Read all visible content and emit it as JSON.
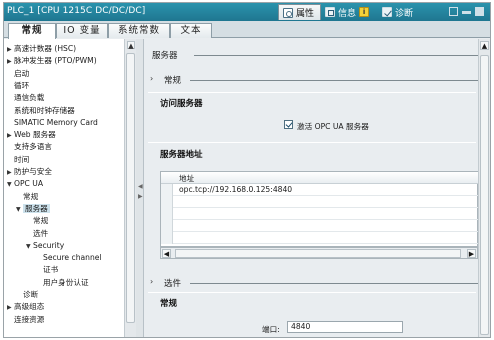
{
  "window": {
    "title": "PLC_1 [CPU 1215C DC/DC/DC]"
  },
  "inspector_tabs": [
    {
      "label": "属性",
      "icon": "properties-icon",
      "active": true
    },
    {
      "label": "信息",
      "icon": "info-icon",
      "badge": "i",
      "active": false
    },
    {
      "label": "诊断",
      "icon": "diagnostics-icon",
      "active": false
    }
  ],
  "property_tabs": [
    {
      "label": "常规",
      "active": true
    },
    {
      "label": "IO 变量",
      "active": false
    },
    {
      "label": "系统常数",
      "active": false
    },
    {
      "label": "文本",
      "active": false
    }
  ],
  "nav": {
    "items": [
      {
        "label": "高速计数器 (HSC)",
        "indent": 0,
        "twisty": "▶"
      },
      {
        "label": "脉冲发生器 (PTO/PWM)",
        "indent": 0,
        "twisty": "▶"
      },
      {
        "label": "启动",
        "indent": 0,
        "twisty": ""
      },
      {
        "label": "循环",
        "indent": 0,
        "twisty": ""
      },
      {
        "label": "通信负载",
        "indent": 0,
        "twisty": ""
      },
      {
        "label": "系统和时钟存储器",
        "indent": 0,
        "twisty": ""
      },
      {
        "label": "SIMATIC Memory Card",
        "indent": 0,
        "twisty": ""
      },
      {
        "label": "Web 服务器",
        "indent": 0,
        "twisty": "▶"
      },
      {
        "label": "支持多语言",
        "indent": 0,
        "twisty": ""
      },
      {
        "label": "时间",
        "indent": 0,
        "twisty": ""
      },
      {
        "label": "防护与安全",
        "indent": 0,
        "twisty": "▶"
      },
      {
        "label": "OPC UA",
        "indent": 0,
        "twisty": "▼"
      },
      {
        "label": "常规",
        "indent": 1,
        "twisty": ""
      },
      {
        "label": "服务器",
        "indent": 1,
        "twisty": "▼",
        "selected": true
      },
      {
        "label": "常规",
        "indent": 2,
        "twisty": ""
      },
      {
        "label": "选件",
        "indent": 2,
        "twisty": ""
      },
      {
        "label": "Security",
        "indent": 2,
        "twisty": "▼"
      },
      {
        "label": "Secure channel",
        "indent": 3,
        "twisty": ""
      },
      {
        "label": "证书",
        "indent": 3,
        "twisty": ""
      },
      {
        "label": "用户身份认证",
        "indent": 3,
        "twisty": ""
      },
      {
        "label": "诊断",
        "indent": 1,
        "twisty": ""
      },
      {
        "label": "高级组态",
        "indent": 0,
        "twisty": "▶"
      },
      {
        "label": "连接资源",
        "indent": 0,
        "twisty": ""
      }
    ]
  },
  "content": {
    "page_title": "服务器",
    "general_section": "常规",
    "access_header": "访问服务器",
    "activate_checkbox": {
      "label": "激活 OPC UA 服务器",
      "checked": true
    },
    "address_header": "服务器地址",
    "address_table": {
      "column": "地址",
      "rows": [
        "opc.tcp://192.168.0.125:4840",
        "",
        "",
        "",
        "",
        "",
        ""
      ]
    },
    "options_section": "选件",
    "options_general_header": "常规",
    "port_label": "端口:",
    "port_value": "4840"
  }
}
